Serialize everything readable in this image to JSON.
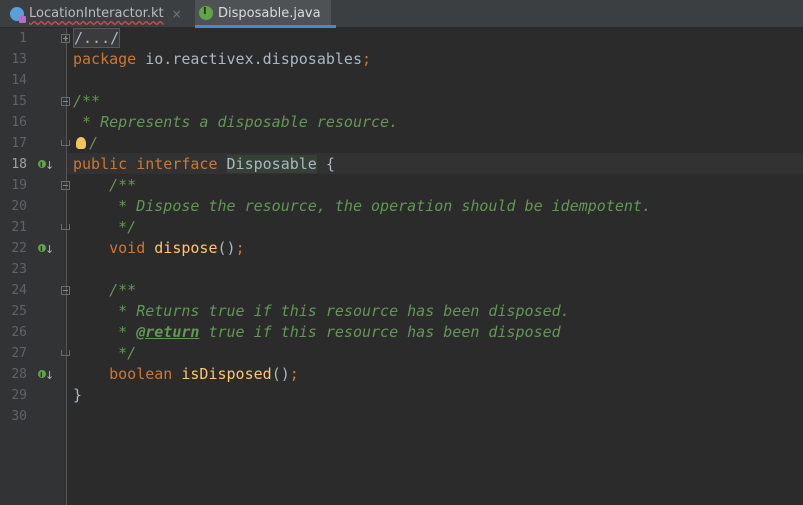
{
  "tabs": [
    {
      "label": "LocationInteractor.kt",
      "close": "×",
      "icon": "kotlin-file-icon"
    },
    {
      "label": "Disposable.java",
      "icon": "java-interface-icon"
    }
  ],
  "line_numbers": [
    "1",
    "13",
    "14",
    "15",
    "16",
    "17",
    "18",
    "19",
    "20",
    "21",
    "22",
    "23",
    "24",
    "25",
    "26",
    "27",
    "28",
    "29",
    "30"
  ],
  "code": {
    "l1_collapsed": "/.../",
    "l13_kw": "package",
    "l13_rest": " io.reactivex.disposables",
    "l13_semi": ";",
    "l15": "/**",
    "l16": " * Represents a disposable resource.",
    "l17": "/",
    "l18_kw1": "public",
    "l18_kw2": "interface",
    "l18_name": "Disposable",
    "l18_brace": " {",
    "l19": "    /**",
    "l20": "     * Dispose the resource, the operation should be idempotent.",
    "l21": "     */",
    "l22_kw": "    void",
    "l22_meth": "dispose",
    "l22_rest": "()",
    "l22_semi": ";",
    "l24": "    /**",
    "l25": "     * Returns true if this resource has been disposed.",
    "l26_pre": "     * ",
    "l26_tag": "@return",
    "l26_post": " true if this resource has been disposed",
    "l27": "     */",
    "l28_kw": "    boolean",
    "l28_meth": "isDisposed",
    "l28_rest": "()",
    "l28_semi": ";",
    "l29": "}"
  }
}
